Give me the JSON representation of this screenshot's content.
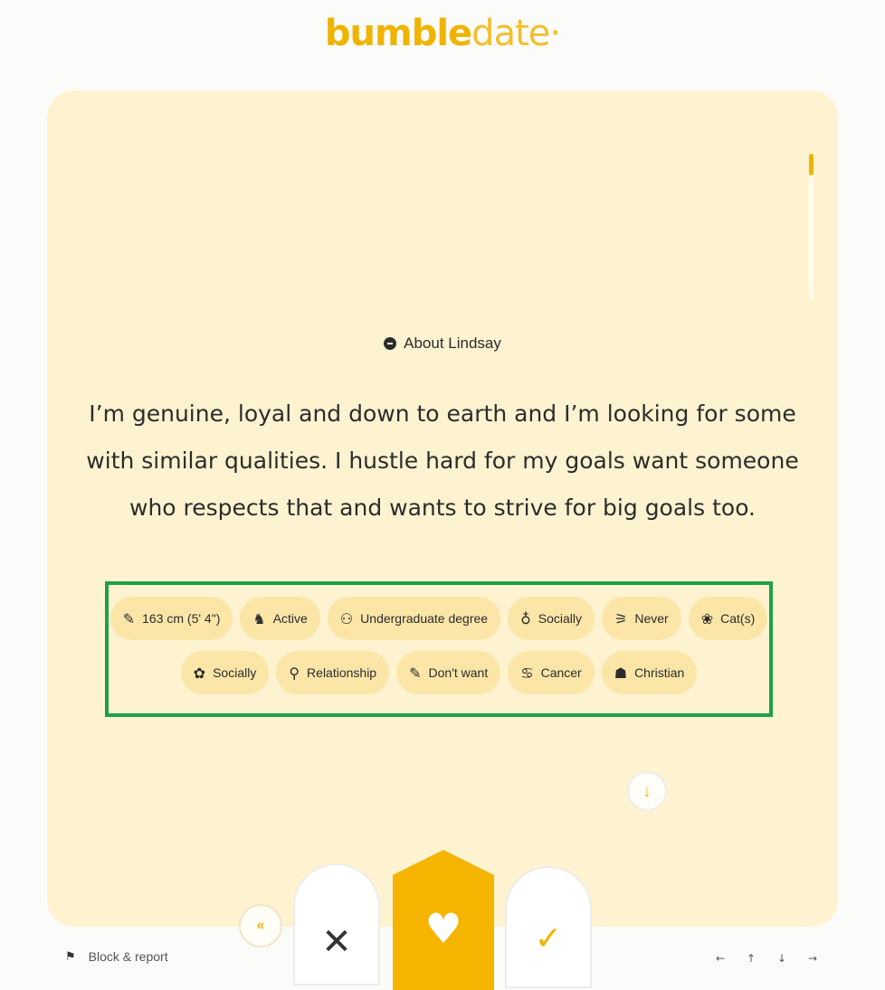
{
  "logo": {
    "brand": "bumble",
    "suffix": "date",
    "dot": "·"
  },
  "profile": {
    "about_heading": "About Lindsay",
    "bio": "I’m genuine, loyal and down to earth and I’m looking for some with similar qualities. I hustle hard for my goals want someone who respects that and wants to strive for big goals too."
  },
  "chips": [
    {
      "icon": "ruler-icon",
      "glyph": "✎",
      "label": "163 cm (5' 4\")"
    },
    {
      "icon": "exercise-icon",
      "glyph": "♞",
      "label": "Active"
    },
    {
      "icon": "graduation-cap-icon",
      "glyph": "⚇",
      "label": "Undergraduate degree"
    },
    {
      "icon": "wine-glass-icon",
      "glyph": "♁",
      "label": "Socially"
    },
    {
      "icon": "smoking-icon",
      "glyph": "⚞",
      "label": "Never"
    },
    {
      "icon": "pets-icon",
      "glyph": "❀",
      "label": "Cat(s)"
    },
    {
      "icon": "cannabis-icon",
      "glyph": "✿",
      "label": "Socially"
    },
    {
      "icon": "search-icon",
      "glyph": "⚲",
      "label": "Relationship"
    },
    {
      "icon": "children-icon",
      "glyph": "✎",
      "label": "Don't want"
    },
    {
      "icon": "zodiac-icon",
      "glyph": "♋",
      "label": "Cancer"
    },
    {
      "icon": "religion-icon",
      "glyph": "☗",
      "label": "Christian"
    }
  ],
  "actions": {
    "back_glyph": "«",
    "pass_glyph": "✕",
    "like_glyph": "♥",
    "superswipe_glyph": "✓",
    "scroll_down_glyph": "↓"
  },
  "footer": {
    "report_glyph": "⚑",
    "report_label": "Block & report",
    "keys": [
      "←",
      "↑",
      "↓",
      "→"
    ]
  },
  "colors": {
    "accent": "#f5b400",
    "card": "#fef3d0",
    "chip": "#fbe6a8",
    "highlight": "#1fa04a"
  }
}
